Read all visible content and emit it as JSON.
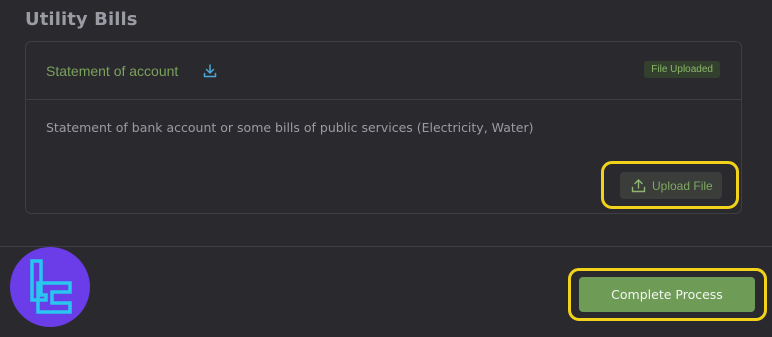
{
  "section": {
    "title": "Utility Bills"
  },
  "document": {
    "title": "Statement of account",
    "download_icon": "download-icon",
    "status": "File Uploaded",
    "description": "Statement of bank account or some bills of public services (Electricity, Water)"
  },
  "upload": {
    "label": "Upload File",
    "icon": "upload-icon"
  },
  "footer": {
    "complete_label": "Complete Process",
    "logo_icon": "brand-logo"
  },
  "colors": {
    "background": "#2a2a2e",
    "accent_green": "#6e9c57",
    "title_green": "#7aa25c",
    "highlight_yellow": "#f2d21a",
    "logo_purple": "#6a3de8",
    "logo_cyan": "#29c6f0"
  }
}
